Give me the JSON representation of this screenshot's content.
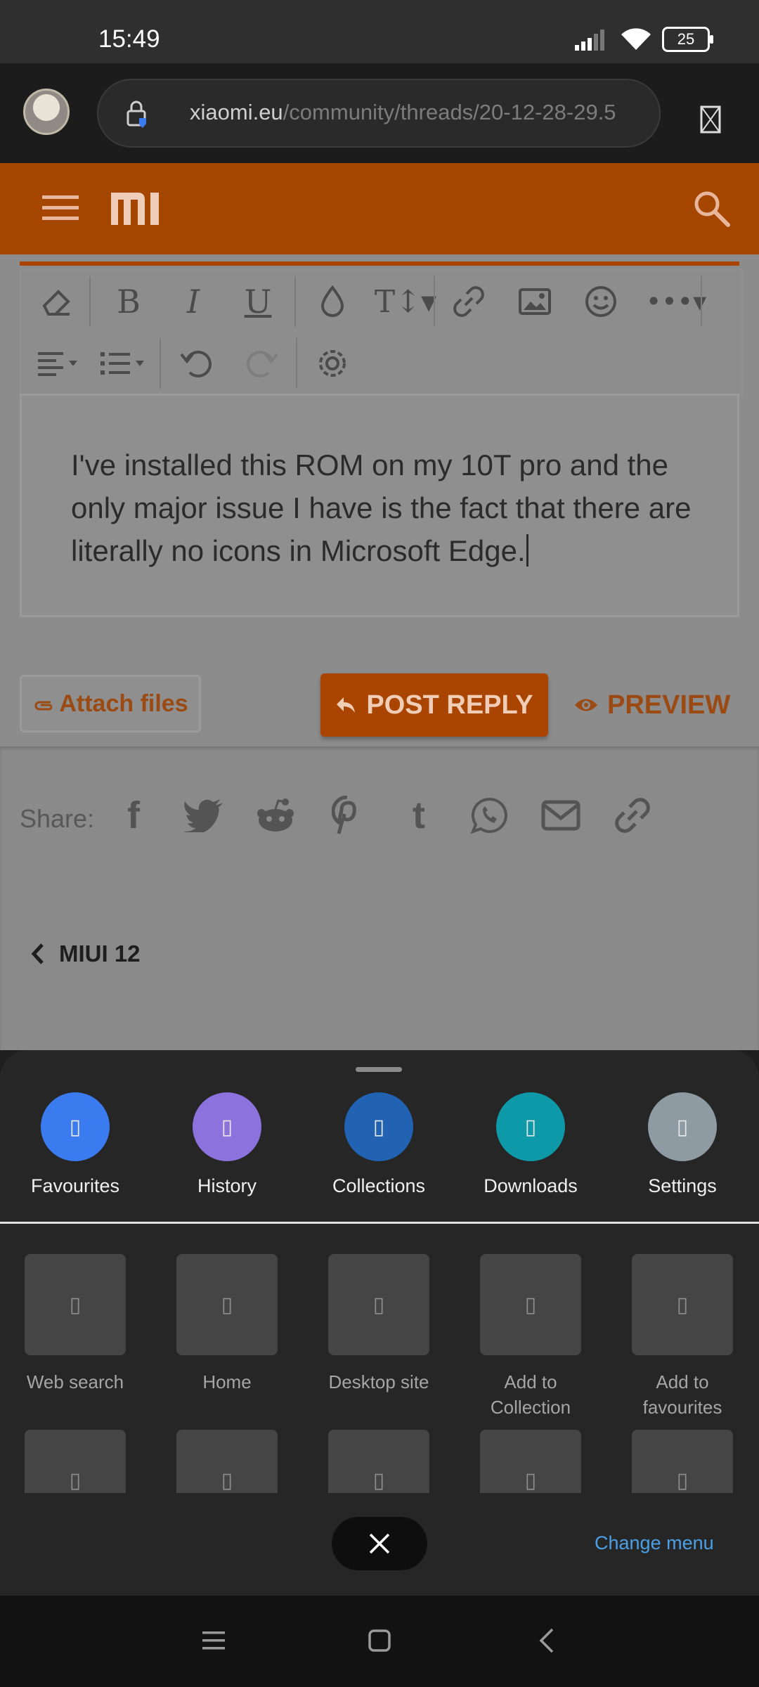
{
  "status_bar": {
    "time": "15:49",
    "battery": "25",
    "icons": [
      "signal-icon",
      "wifi-icon",
      "battery-icon"
    ]
  },
  "browser": {
    "url_domain": "xiaomi.eu",
    "url_path": "/community/threads/20-12-28-29.5",
    "icons": [
      "avatar",
      "lock-icon",
      "tabs-icon"
    ]
  },
  "site_header": {
    "logo": "mi",
    "icons": [
      "hamburger-icon",
      "search-icon"
    ]
  },
  "editor": {
    "toolbar_row1": [
      "eraser-icon",
      "bold-icon",
      "italic-icon",
      "underline-icon",
      "text-color-icon",
      "font-size-icon",
      "link-icon",
      "image-icon",
      "emoji-icon",
      "more-icon"
    ],
    "toolbar_row2": [
      "align-icon",
      "list-icon",
      "undo-icon",
      "redo-icon",
      "settings-icon"
    ],
    "text": "I've installed this ROM on my 10T pro and the only major issue I have is the fact that there are literally no icons in Microsoft Edge."
  },
  "actions": {
    "attach_label": "Attach files",
    "post_reply_label": "POST REPLY",
    "preview_label": "PREVIEW"
  },
  "share": {
    "label": "Share:",
    "icons": [
      "facebook-icon",
      "twitter-icon",
      "reddit-icon",
      "pinterest-icon",
      "tumblr-icon",
      "whatsapp-icon",
      "email-icon",
      "link-icon"
    ]
  },
  "breadcrumb": {
    "label": "MIUI 12"
  },
  "sheet": {
    "quick_actions": [
      {
        "label": "Favourites",
        "color": "#3b7bf0"
      },
      {
        "label": "History",
        "color": "#8b72dd"
      },
      {
        "label": "Collections",
        "color": "#2162b3"
      },
      {
        "label": "Downloads",
        "color": "#0d99a8"
      },
      {
        "label": "Settings",
        "color": "#8e9ba2"
      }
    ],
    "grid_items": [
      {
        "label": "Web search"
      },
      {
        "label": "Home"
      },
      {
        "label": "Desktop site"
      },
      {
        "label": "Add to\nCollection"
      },
      {
        "label": "Add to\nfavourites"
      }
    ],
    "change_menu_label": "Change menu",
    "missing_glyph": "▯"
  },
  "nav_bar": {
    "icons": [
      "menu-icon",
      "home-icon",
      "back-icon"
    ]
  }
}
